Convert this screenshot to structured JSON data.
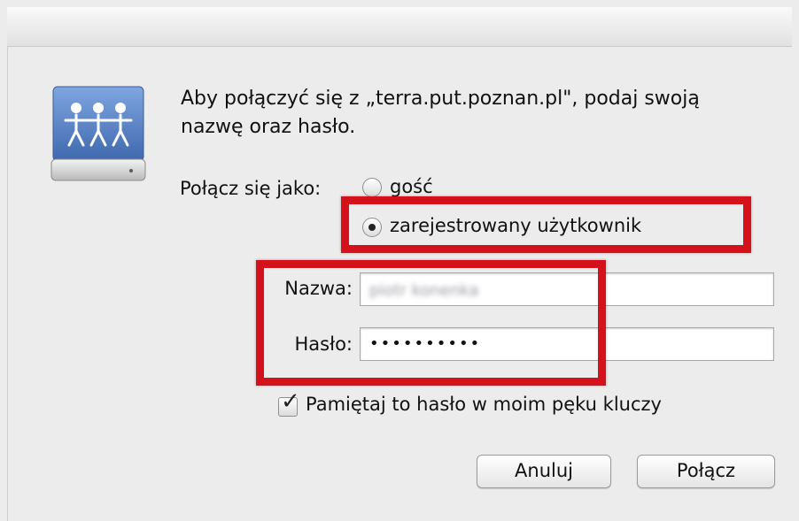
{
  "dialog": {
    "message_line1": "Aby połączyć się z „terra.put.poznan.pl\", podaj swoją",
    "message_line2": "nazwę oraz hasło."
  },
  "connect_as": {
    "label": "Połącz się jako:",
    "options": [
      {
        "label": "gość",
        "selected": false
      },
      {
        "label": "zarejestrowany użytkownik",
        "selected": true
      }
    ]
  },
  "fields": {
    "name_label": "Nazwa:",
    "name_value": "piotr konenka",
    "password_label": "Hasło:",
    "password_value": "••••••••••"
  },
  "keychain": {
    "label": "Pamiętaj to hasło w moim pęku kluczy",
    "checked": true
  },
  "buttons": {
    "cancel": "Anuluj",
    "connect": "Połącz"
  },
  "colors": {
    "highlight": "#d3121b",
    "icon_blue": "#4d7ac2"
  },
  "icons": {
    "server": "network-server-icon",
    "checkmark": "checkmark-icon"
  }
}
